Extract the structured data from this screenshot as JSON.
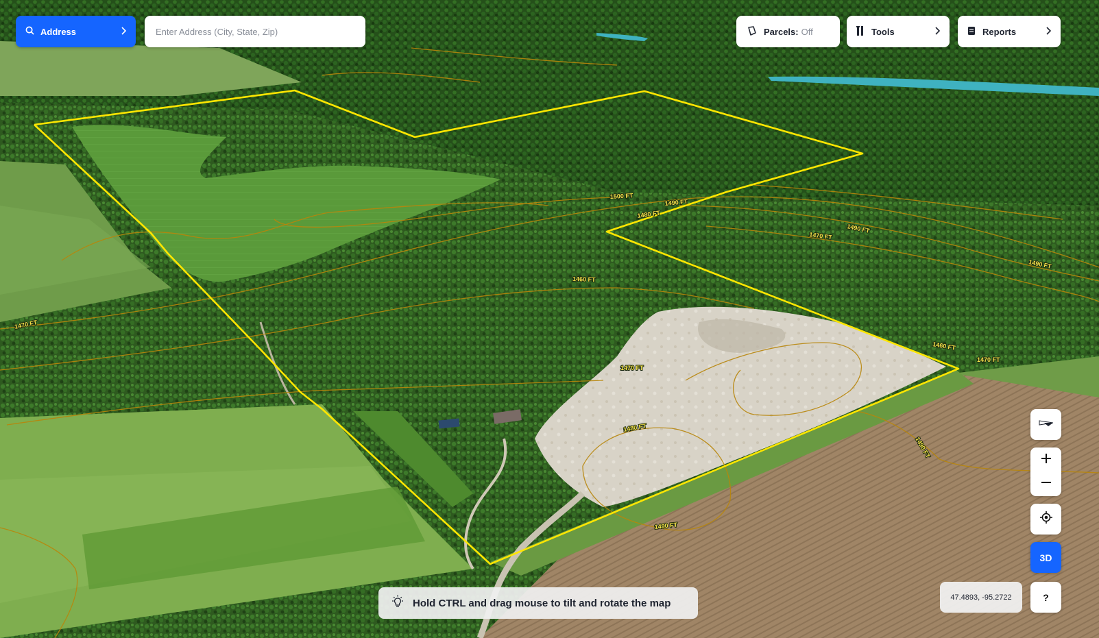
{
  "search": {
    "mode_label": "Address",
    "placeholder": "Enter Address (City, State, Zip)",
    "value": ""
  },
  "toolbar": {
    "parcels_label": "Parcels:",
    "parcels_state": "Off",
    "tools_label": "Tools",
    "reports_label": "Reports"
  },
  "controls": {
    "zoom_in": "+",
    "zoom_out": "−",
    "view_mode": "3D",
    "help": "?"
  },
  "map": {
    "coordinates": "47.4893, -95.2722",
    "hint": "Hold CTRL and drag mouse to tilt and rotate the map",
    "boundary_color": "#ffe600",
    "contour_color": "#b8860b",
    "contour_labels": [
      "1500 FT",
      "1490 FT",
      "1480 FT",
      "1470 FT",
      "1460 FT",
      "1490 FT",
      "1480 FT",
      "1470 FT",
      "1460 FT",
      "1470 FT",
      "1490 FT",
      "1490 FT",
      "1490 FT",
      "1470 FT"
    ]
  },
  "colors": {
    "accent": "#1565ff",
    "panel_bg": "#ffffff"
  }
}
